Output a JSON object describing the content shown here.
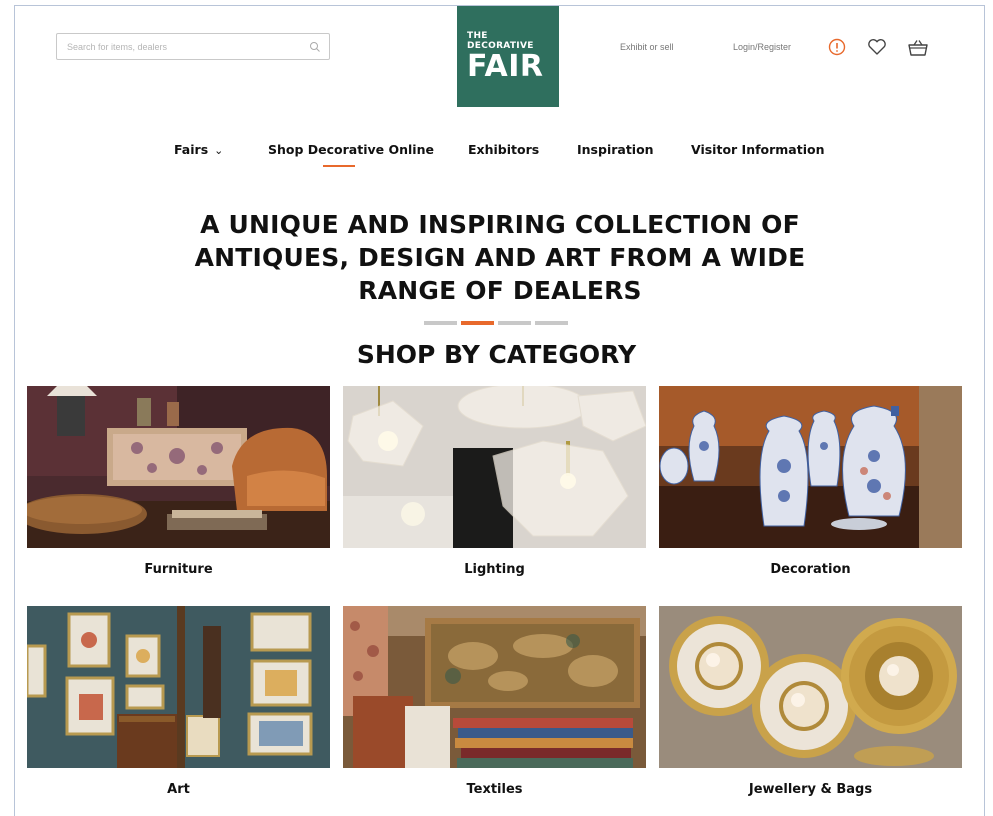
{
  "header": {
    "search_placeholder": "Search for items, dealers",
    "logo": {
      "line1": "THE",
      "line2": "DECORATIVE",
      "line3": "FAIR"
    },
    "exhibit_link": "Exhibit or sell",
    "login_link": "Login/Register",
    "icons": [
      "search-icon",
      "info-icon",
      "heart-icon",
      "basket-icon"
    ],
    "accent_color": "#e8692c",
    "brand_color": "#2f6f5e"
  },
  "nav": {
    "items": [
      {
        "label": "Fairs",
        "has_dropdown": true
      },
      {
        "label": "Shop Decorative Online",
        "active": true
      },
      {
        "label": "Exhibitors"
      },
      {
        "label": "Inspiration"
      },
      {
        "label": "Visitor Information"
      }
    ]
  },
  "hero": {
    "line1": "A UNIQUE AND INSPIRING COLLECTION OF",
    "line2": "ANTIQUES, DESIGN AND ART FROM A WIDE",
    "line3": "RANGE OF DEALERS",
    "carousel_count": 4,
    "carousel_active": 2
  },
  "section_title": "SHOP BY CATEGORY",
  "categories": [
    {
      "label": "Furniture"
    },
    {
      "label": "Lighting"
    },
    {
      "label": "Decoration"
    },
    {
      "label": "Art"
    },
    {
      "label": "Textiles"
    },
    {
      "label": "Jewellery & Bags"
    }
  ]
}
